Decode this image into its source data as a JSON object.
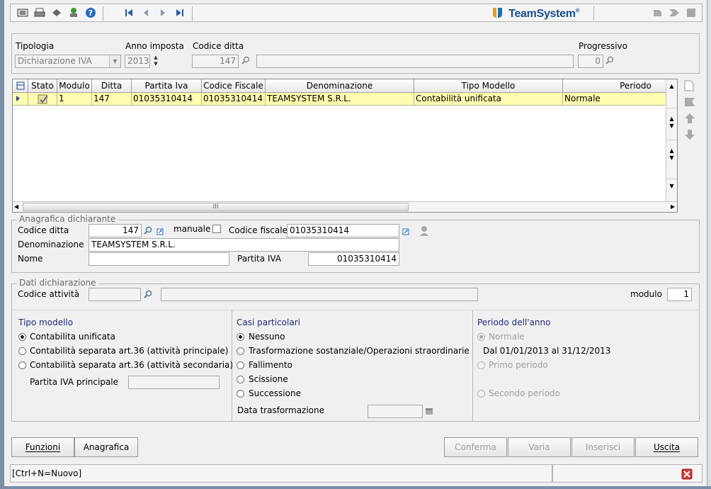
{
  "toolbar": {
    "icons": [
      "print-preview-icon",
      "print-icon",
      "tools-icon",
      "export-icon",
      "help-icon",
      "first-record-icon",
      "prev-record-icon",
      "next-record-icon",
      "last-record-icon"
    ],
    "logo_text": "TeamSystem",
    "logo_reg": "®"
  },
  "header": {
    "tipologia_label": "Tipologia",
    "tipologia_value": "Dichiarazione IVA",
    "anno_label": "Anno imposta",
    "anno_value": "2013",
    "codice_ditta_label": "Codice ditta",
    "codice_ditta_value": "147",
    "progressivo_label": "Progressivo",
    "progressivo_value": "0"
  },
  "grid": {
    "columns": [
      "Stato",
      "Modulo",
      "Ditta",
      "Partita Iva",
      "Codice Fiscale",
      "Denominazione",
      "Tipo Modello",
      "Periodo"
    ],
    "rows": [
      {
        "modulo": "1",
        "ditta": "147",
        "partita_iva": "01035310414",
        "codice_fiscale": "01035310414",
        "denominazione": "TEAMSYSTEM S.R.L.",
        "tipo_modello": "Contabilità unificata",
        "periodo": "Normale"
      }
    ],
    "hscroll_grip": "III"
  },
  "anagrafica": {
    "legend": "Anagrafica dichiarante",
    "codice_ditta_label": "Codice ditta",
    "codice_ditta_value": "147",
    "manuale_label": "manuale",
    "codice_fiscale_label": "Codice fiscale",
    "codice_fiscale_value": "01035310414",
    "denominazione_label": "Denominazione",
    "denominazione_value": "TEAMSYSTEM S.R.L.",
    "nome_label": "Nome",
    "nome_value": "",
    "partita_iva_label": "Partita IVA",
    "partita_iva_value": "01035310414"
  },
  "dati": {
    "legend": "Dati dichiarazione",
    "codice_attivita_label": "Codice attività",
    "codice_attivita_value": "",
    "modulo_label": "modulo",
    "modulo_value": "1"
  },
  "tipo_modello": {
    "title": "Tipo modello",
    "options": [
      "Contabilita unificata",
      "Contabilità separata art.36 (attività principale)",
      "Contabilità separata art.36 (attività secondaria)"
    ],
    "selected": 0,
    "partita_iva_principale_label": "Partita IVA principale",
    "partita_iva_principale_value": ""
  },
  "casi": {
    "title": "Casi particolari",
    "options": [
      "Nessuno",
      "Trasformazione sostanziale/Operazioni straordinarie",
      "Fallimento",
      "Scissione",
      "Successione"
    ],
    "selected": 0,
    "data_trasformazione_label": "Data trasformazione",
    "data_trasformazione_value": ""
  },
  "periodo": {
    "title": "Periodo dell'anno",
    "normale_label": "Normale",
    "range_text": "Dal 01/01/2013 al 31/12/2013",
    "primo_label": "Primo periodo",
    "secondo_label": "Secondo periodo"
  },
  "buttons": {
    "funzioni": "Funzioni",
    "anagrafica": "Anagrafica",
    "conferma": "Conferma",
    "varia": "Varia",
    "inserisci": "Inserisci",
    "uscita": "Uscita"
  },
  "status": {
    "text": "[Ctrl+N=Nuovo]"
  },
  "colors": {
    "selected_row": "#fffcb0",
    "section_title": "#1f2a7a",
    "logo": "#1a4f8f",
    "close_icon": "#cc2222"
  }
}
